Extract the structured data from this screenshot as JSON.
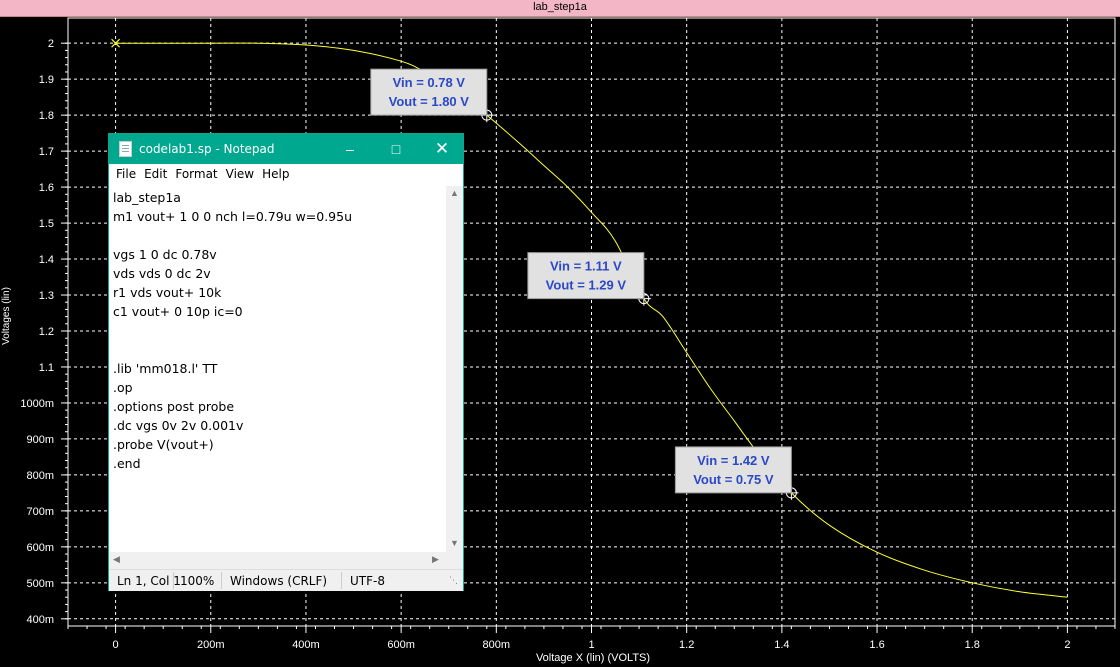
{
  "window_title": "lab_step1a",
  "chart_data": {
    "type": "line",
    "title": "",
    "xlabel": "Voltage X (lin) (VOLTS)",
    "ylabel": "Voltages (lin)",
    "xlim": [
      -0.1,
      2.1
    ],
    "ylim": [
      0.38,
      2.07
    ],
    "x_ticks": [
      {
        "v": 0,
        "label": "0"
      },
      {
        "v": 0.2,
        "label": "200m"
      },
      {
        "v": 0.4,
        "label": "400m"
      },
      {
        "v": 0.6,
        "label": "600m"
      },
      {
        "v": 0.8,
        "label": "800m"
      },
      {
        "v": 1.0,
        "label": "1"
      },
      {
        "v": 1.2,
        "label": "1.2"
      },
      {
        "v": 1.4,
        "label": "1.4"
      },
      {
        "v": 1.6,
        "label": "1.6"
      },
      {
        "v": 1.8,
        "label": "1.8"
      },
      {
        "v": 2.0,
        "label": "2"
      }
    ],
    "y_ticks": [
      {
        "v": 2.0,
        "label": "2"
      },
      {
        "v": 1.9,
        "label": "1.9"
      },
      {
        "v": 1.8,
        "label": "1.8"
      },
      {
        "v": 1.7,
        "label": "1.7"
      },
      {
        "v": 1.6,
        "label": "1.6"
      },
      {
        "v": 1.5,
        "label": "1.5"
      },
      {
        "v": 1.4,
        "label": "1.4"
      },
      {
        "v": 1.3,
        "label": "1.3"
      },
      {
        "v": 1.2,
        "label": "1.2"
      },
      {
        "v": 1.1,
        "label": "1.1"
      },
      {
        "v": 1.0,
        "label": "1000m"
      },
      {
        "v": 0.9,
        "label": "900m"
      },
      {
        "v": 0.8,
        "label": "800m"
      },
      {
        "v": 0.7,
        "label": "700m"
      },
      {
        "v": 0.6,
        "label": "600m"
      },
      {
        "v": 0.5,
        "label": "500m"
      },
      {
        "v": 0.4,
        "label": "400m"
      }
    ],
    "grid": true,
    "background": "#000000",
    "line_color": "#ffff33",
    "series": [
      {
        "x": [
          0,
          0.1,
          0.2,
          0.3,
          0.4,
          0.5,
          0.6,
          0.65,
          0.7,
          0.75,
          0.78,
          0.85,
          0.9,
          0.95,
          1.0,
          1.05,
          1.11,
          1.15,
          1.2,
          1.25,
          1.3,
          1.35,
          1.42,
          1.5,
          1.6,
          1.7,
          1.8,
          1.9,
          2.0
        ],
        "values": [
          2.0,
          2.0,
          2.0,
          2.0,
          1.995,
          1.98,
          1.95,
          1.92,
          1.88,
          1.83,
          1.8,
          1.72,
          1.66,
          1.6,
          1.53,
          1.45,
          1.29,
          1.24,
          1.14,
          1.04,
          0.95,
          0.86,
          0.75,
          0.66,
          0.585,
          0.535,
          0.5,
          0.475,
          0.46
        ]
      }
    ],
    "start_marker": {
      "x": 0,
      "y": 2.0
    },
    "annotations": [
      {
        "x": 0.78,
        "y": 1.8,
        "line1": "Vin = 0.78 V",
        "line2": "Vout = 1.80 V"
      },
      {
        "x": 1.11,
        "y": 1.29,
        "line1": "Vin = 1.11 V",
        "line2": "Vout = 1.29 V"
      },
      {
        "x": 1.42,
        "y": 0.75,
        "line1": "Vin = 1.42 V",
        "line2": "Vout = 0.75 V"
      }
    ]
  },
  "notepad": {
    "title": "codelab1.sp - Notepad",
    "menu": {
      "file": "File",
      "edit": "Edit",
      "format": "Format",
      "view": "View",
      "help": "Help"
    },
    "content": "lab_step1a\nm1 vout+ 1 0 0 nch l=0.79u w=0.95u\n\nvgs 1 0 dc 0.78v\nvds vds 0 dc 2v\nr1 vds vout+ 10k\nc1 vout+ 0 10p ic=0\n\n\n.lib 'mm018.l' TT\n.op\n.options post probe\n.dc vgs 0v 2v 0.001v\n.probe V(vout+)\n.end",
    "status": {
      "position": "Ln 1, Col 1",
      "zoom": "100%",
      "line_ending": "Windows (CRLF)",
      "encoding": "UTF-8"
    }
  }
}
